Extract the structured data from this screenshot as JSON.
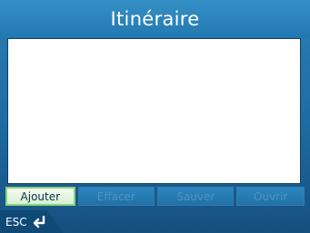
{
  "window": {
    "title": "Itinéraire"
  },
  "route_list": {
    "items": []
  },
  "buttons": {
    "add": "Ajouter",
    "clear": "Effacer",
    "save": "Sauver",
    "load": "Ouvrir"
  },
  "footer": {
    "esc_label": "ESC"
  },
  "colors": {
    "background": "#1e6aa0",
    "title_bar": "#2378b0",
    "active_button": "#d8efd2",
    "active_border": "#8bd17a",
    "disabled_text": "#4c95c6"
  },
  "icons": {
    "back": "return-arrow-icon"
  }
}
